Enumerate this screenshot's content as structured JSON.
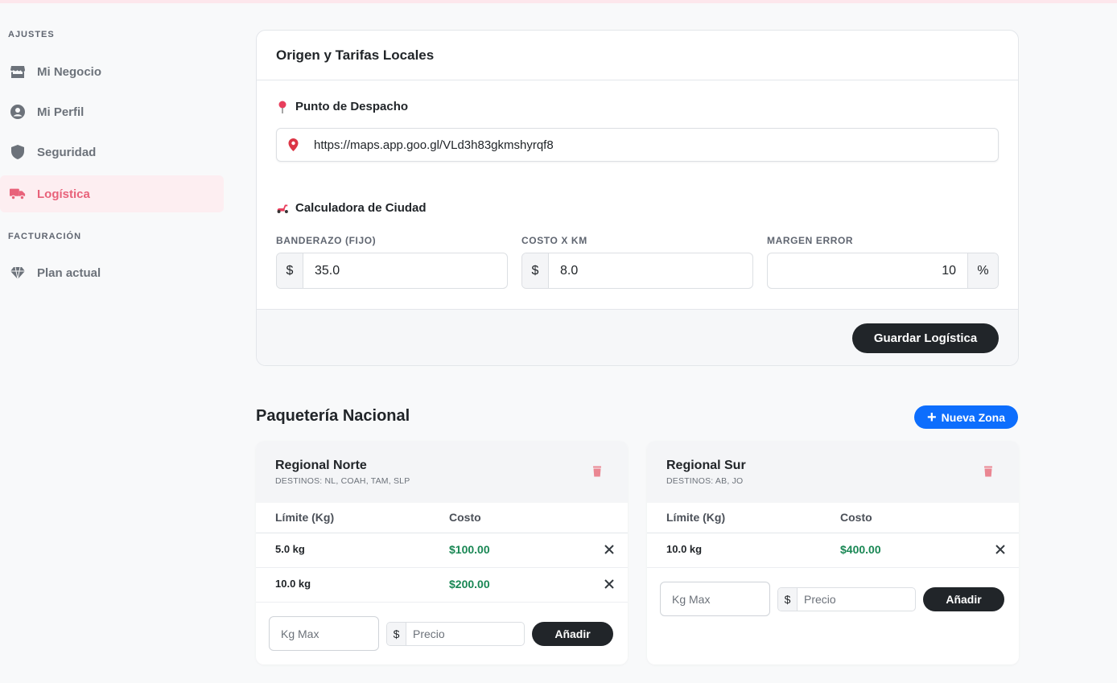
{
  "sidebar": {
    "heading_settings": "AJUSTES",
    "items": [
      {
        "label": "Mi Negocio",
        "icon": "store-icon"
      },
      {
        "label": "Mi Perfil",
        "icon": "user-circle-icon"
      },
      {
        "label": "Seguridad",
        "icon": "shield-icon"
      },
      {
        "label": "Logística",
        "icon": "truck-icon",
        "active": true
      }
    ],
    "heading_billing": "FACTURACIÓN",
    "billing_items": [
      {
        "label": "Plan actual",
        "icon": "gem-icon"
      }
    ]
  },
  "origin_card": {
    "title": "Origen y Tarifas Locales",
    "dispatch_title": "Punto de Despacho",
    "dispatch_url": "https://maps.app.goo.gl/VLd3h83gkmshyrqf8",
    "calc_title": "Calculadora de Ciudad",
    "fields": {
      "flag_label": "BANDERAZO (FIJO)",
      "flag_prefix": "$",
      "flag_value": "35.0",
      "km_label": "COSTO X KM",
      "km_prefix": "$",
      "km_value": "8.0",
      "margin_label": "MARGEN ERROR",
      "margin_value": "10",
      "margin_suffix": "%"
    },
    "save_button": "Guardar Logística"
  },
  "national": {
    "title": "Paquetería Nacional",
    "new_zone_button": "Nueva Zona",
    "col_limit": "Límite (Kg)",
    "col_cost": "Costo",
    "kg_placeholder": "Kg Max",
    "price_prefix": "$",
    "price_placeholder": "Precio",
    "add_button": "Añadir",
    "zones": [
      {
        "name": "Regional Norte",
        "destinations": "DESTINOS: NL, COAH, TAM, SLP",
        "rows": [
          {
            "kg": "5.0 kg",
            "cost": "$100.00"
          },
          {
            "kg": "10.0 kg",
            "cost": "$200.00"
          }
        ]
      },
      {
        "name": "Regional Sur",
        "destinations": "DESTINOS: AB, JO",
        "rows": [
          {
            "kg": "10.0 kg",
            "cost": "$400.00"
          }
        ]
      }
    ]
  },
  "colors": {
    "accent_pink": "#e8627a",
    "primary_blue": "#0d6efd",
    "success_green": "#198754",
    "dark_button": "#212529"
  }
}
